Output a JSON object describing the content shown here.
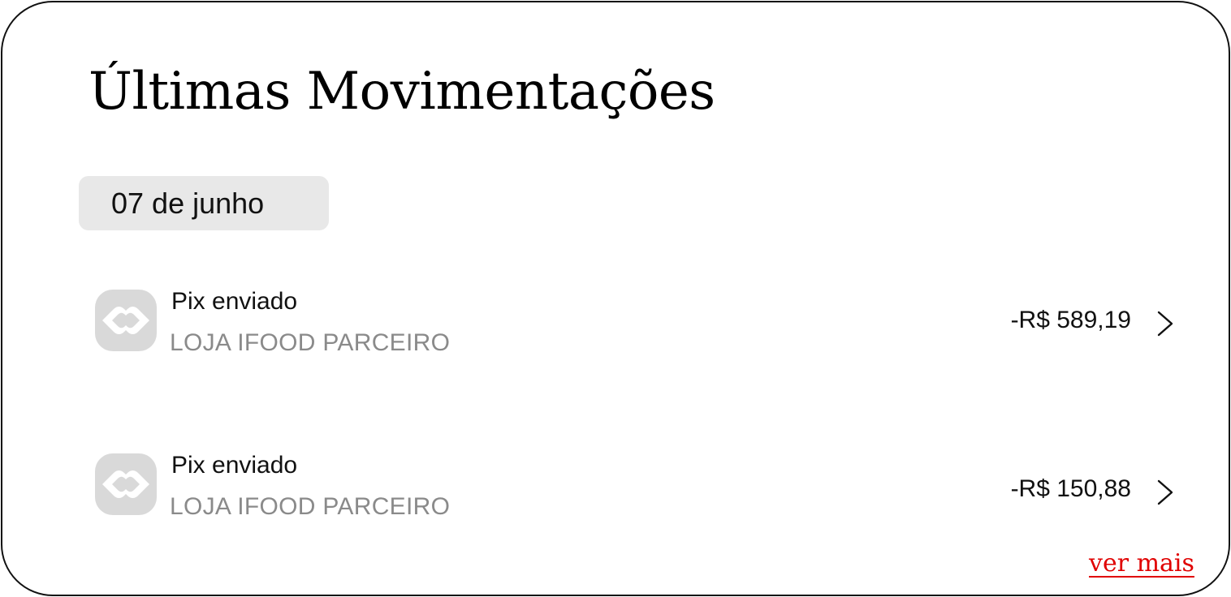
{
  "card": {
    "title": "Últimas Movimentações",
    "date_label": "07 de junho",
    "transactions": [
      {
        "type": "Pix enviado",
        "merchant": "LOJA IFOOD PARCEIRO",
        "amount": "-R$ 589,19",
        "icon": "pix-icon"
      },
      {
        "type": "Pix enviado",
        "merchant": "LOJA IFOOD PARCEIRO",
        "amount": "-R$ 150,88",
        "icon": "pix-icon"
      }
    ],
    "more_link": "ver mais"
  },
  "colors": {
    "text": "#111111",
    "muted": "#8a8a8a",
    "chip_bg": "#e8e8e8",
    "icon_gray": "#d9d9d9",
    "link": "#e00000",
    "border": "#111111"
  }
}
